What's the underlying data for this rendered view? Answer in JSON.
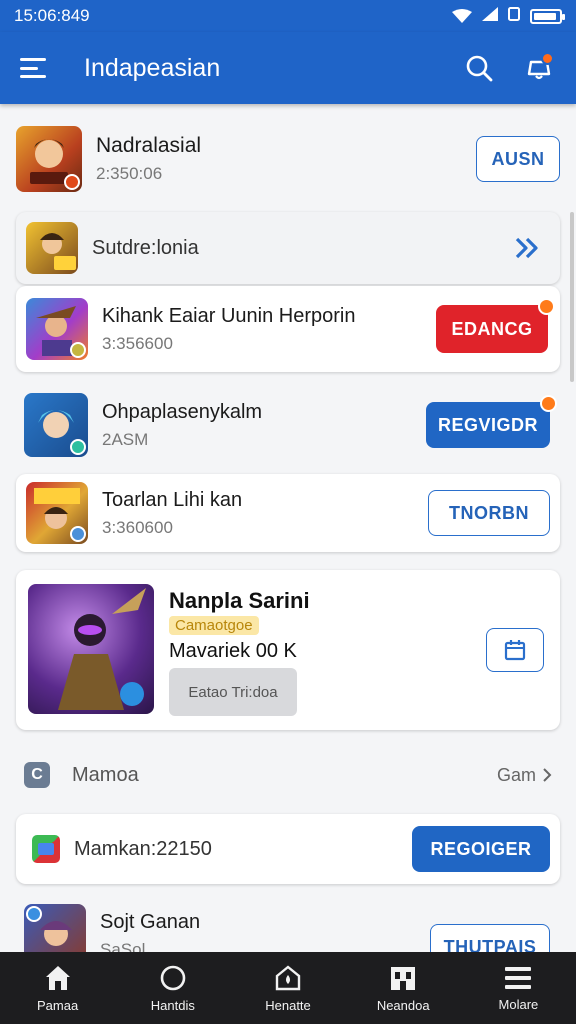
{
  "status_bar": {
    "time": "15:06:849"
  },
  "app_bar": {
    "title": "Indapeasian"
  },
  "rows": [
    {
      "name": "Nadralasial",
      "sub": "2:350:06",
      "button": "AUSN"
    },
    {
      "name": "Sutdre:lonia"
    },
    {
      "name": "Kihank Eaiar Uunin Herporin",
      "sub": "3:356600",
      "button": "EDANCG"
    },
    {
      "name": "Ohpaplasenykalm",
      "sub": "2ASM",
      "button": "REGVIGDR"
    },
    {
      "name": "Toarlan Lihi kan",
      "sub": "3:360600",
      "button": "TNORBN"
    }
  ],
  "featured": {
    "title": "Nanpla Sarini",
    "tag": "Camaotgoe",
    "price": "Mavariek 00 K",
    "secondary_label": "Eatao Tri:doa"
  },
  "section": {
    "icon_letter": "C",
    "label": "Mamoa",
    "see_all": "Gam"
  },
  "promo": {
    "text": "Mamkan:22150",
    "button": "REGOIGER"
  },
  "last_row": {
    "name": "Sojt Ganan",
    "sub": "SaSol",
    "button": "THUTPAIS"
  },
  "bottom_nav": [
    "Pamaa",
    "Hantdis",
    "Henatte",
    "Neandoa",
    "Molare"
  ],
  "colors": {
    "primary": "#1f64c8",
    "accent": "#ff7b1a",
    "danger": "#e0232a"
  }
}
